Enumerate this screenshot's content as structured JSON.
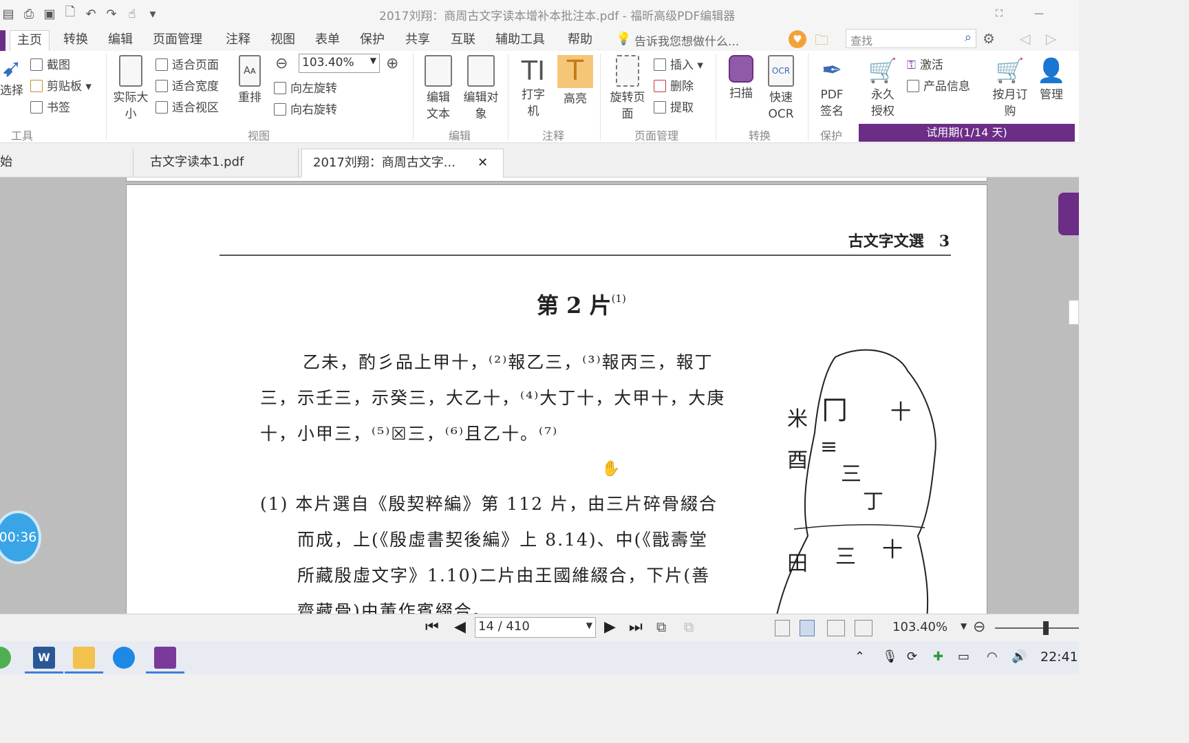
{
  "title": "2017刘翔：商周古文字读本增补本批注本.pdf - 福昕高级PDF编辑器",
  "menu": [
    "主页",
    "转换",
    "编辑",
    "页面管理",
    "注释",
    "视图",
    "表单",
    "保护",
    "共享",
    "互联",
    "辅助工具",
    "帮助"
  ],
  "tell_me": "告诉我您想做什么...",
  "search_placeholder": "查找",
  "ribbon": {
    "select": "选择",
    "screenshot": "截图",
    "clipboard": "剪贴板",
    "bookmark": "书签",
    "group_tools": "工具",
    "actual_size": "实际大小",
    "fit_page": "适合页面",
    "fit_width": "适合宽度",
    "fit_visible": "适合视区",
    "reflow": "重排",
    "zoom_value": "103.40%",
    "rotate_left": "向左旋转",
    "rotate_right": "向右旋转",
    "group_view": "视图",
    "edit_text": "编辑文本",
    "edit_object": "编辑对象",
    "group_edit": "编辑",
    "typewriter": "打字机",
    "highlight": "高亮",
    "group_comment": "注释",
    "rotate_pages": "旋转页面",
    "insert": "插入",
    "delete": "删除",
    "extract": "提取",
    "group_page": "页面管理",
    "scan": "扫描",
    "quick_ocr": "快速OCR",
    "group_convert": "转换",
    "pdf_sign": "PDF签名",
    "group_protect": "保护",
    "permanent": "永久授权",
    "activate": "激活",
    "product_info": "产品信息",
    "monthly": "按月订购",
    "manage": "管理",
    "trial": "试用期(1/14 天)"
  },
  "tabs": [
    "始",
    "古文字读本1.pdf",
    "2017刘翔：商周古文字..."
  ],
  "document": {
    "running_head": "古文字文選　3",
    "piece_title": "第 2 片",
    "piece_note": "(1)",
    "lines": [
      "乙未，酌彡品上甲十，⁽²⁾報乙三，⁽³⁾報丙三，報丁",
      "三，示壬三，示癸三，大乙十，⁽⁴⁾大丁十，大甲十，大庚",
      "十，小甲三，⁽⁵⁾☒三，⁽⁶⁾且乙十。⁽⁷⁾",
      "(1) 本片選自《殷契粹編》第 112 片，由三片碎骨綴合",
      "而成，上(《殷虛書契後編》上 8.14)、中(《戩壽堂",
      "所藏殷虛文字》1.10)二片由王國維綴合，下片(善",
      "齋藏骨)由董作賓綴合。"
    ]
  },
  "timer": "00:36",
  "nav": {
    "page_display": "14 / 410",
    "zoom": "103.40%"
  },
  "clock": "22:41",
  "colors": {
    "accent": "#6b2d86",
    "highlight": "#f6c678",
    "timer": "#3aa5e6"
  }
}
